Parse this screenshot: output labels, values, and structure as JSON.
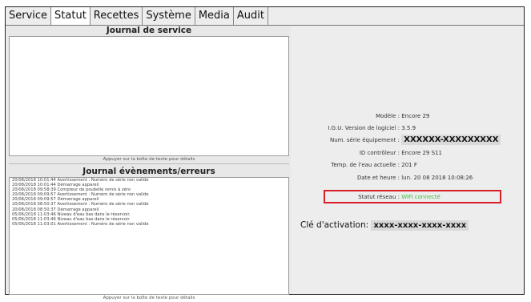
{
  "tabs": [
    "Service",
    "Statut",
    "Recettes",
    "Système",
    "Media",
    "Audit"
  ],
  "active_tab": "Statut",
  "service_log": {
    "title": "Journal de service",
    "hint": "Appuyer sur la boîte de texte pour détails"
  },
  "events_log": {
    "title": "Journal évènements/erreurs",
    "hint": "Appuyer sur la boîte de texte pour détails",
    "lines": [
      "20/08/2018 10:01:44 Avertissement : Numéro de série non valide",
      "20/08/2018 10:01:44 Démarrage appareil",
      "20/08/2018 09:58:39 Compteur de poubelle remis à zéro",
      "20/08/2018 09:09:57 Avertissement : Numéro de série non valide",
      "20/08/2018 09:09:57 Démarrage appareil",
      "20/08/2018 08:50:37 Avertissement : Numéro de série non valide",
      "20/08/2018 08:50:37 Démarrage appareil",
      "05/06/2018 11:03:46 Niveau d'eau bas dans le réservoir.",
      "05/06/2018 11:03:46 Niveau d'eau bas dans le réservoir.",
      "05/06/2018 11:03:01 Avertissement : Numéro de série non valide"
    ]
  },
  "status": {
    "model_label": "Modèle :",
    "model_value": "Encore 29",
    "sw_label": "I.G.U. Version de logiciel :",
    "sw_value": "3.5.9",
    "serial_label": "Num. série équipement :",
    "serial_value": "XXXXXX-XXXXXXXXX",
    "controller_label": "ID contrôleur :",
    "controller_value": "Encore 29  S11",
    "temp_label": "Temp. de l'eau actuelle :",
    "temp_value": "201 F",
    "datetime_label": "Date et heure :",
    "datetime_value": "lun. 20 08 2018 10:08:26",
    "network_label": "Statut réseau :",
    "network_value": "WiFi connecté",
    "activation_label": "Clé d'activation:",
    "activation_value": "xxxx-xxxx-xxxx-xxxx"
  },
  "colors": {
    "highlight_border": "#d61f27",
    "network_ok": "#3cbf3c"
  }
}
